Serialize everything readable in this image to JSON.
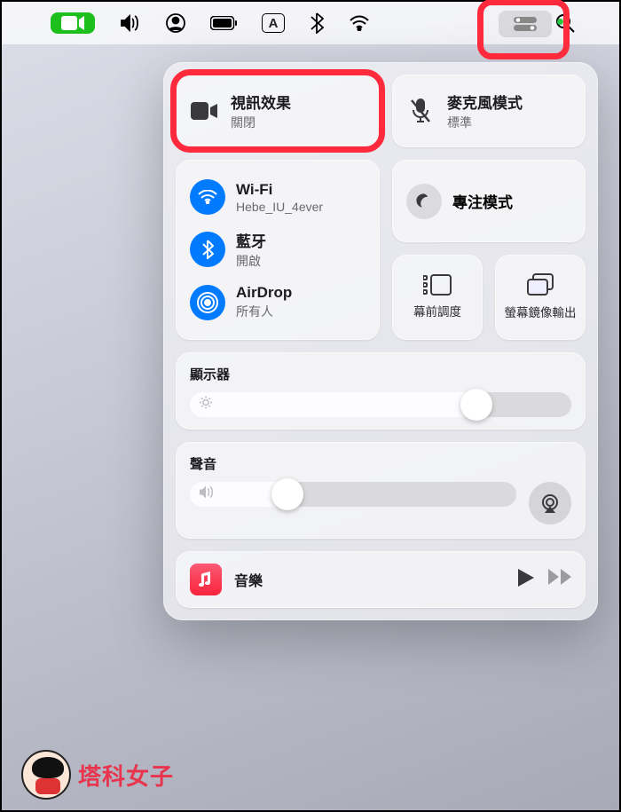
{
  "menubar": {
    "icons": [
      "facetime",
      "volume",
      "user",
      "battery",
      "input-A",
      "bluetooth",
      "wifi",
      "control-center",
      "search"
    ]
  },
  "control_center": {
    "video_effects": {
      "title": "視訊效果",
      "status": "關閉"
    },
    "mic_mode": {
      "title": "麥克風模式",
      "status": "標準"
    },
    "wifi": {
      "title": "Wi-Fi",
      "network": "Hebe_IU_4ever"
    },
    "bluetooth": {
      "title": "藍牙",
      "status": "開啟"
    },
    "airdrop": {
      "title": "AirDrop",
      "status": "所有人"
    },
    "focus": {
      "title": "專注模式"
    },
    "stage_manager": {
      "label": "幕前調度"
    },
    "screen_mirroring": {
      "label": "螢幕鏡像輸出"
    },
    "display": {
      "title": "顯示器",
      "brightness_pct": 75
    },
    "sound": {
      "title": "聲音",
      "volume_pct": 30
    },
    "music": {
      "title": "音樂"
    }
  },
  "watermark": {
    "text": "塔科女子"
  },
  "highlights": [
    "video-effects-tile",
    "control-center-menubar-button"
  ]
}
